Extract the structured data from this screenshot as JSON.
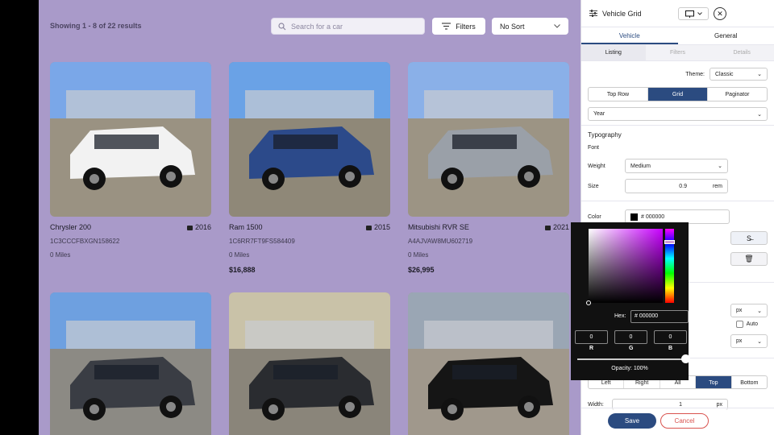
{
  "header": {
    "results_text": "Showing 1 - 8 of 22 results",
    "search_placeholder": "Search for a car",
    "filters_label": "Filters",
    "sort_label": "No Sort"
  },
  "cars": [
    {
      "name": "Chrysler 200",
      "year": "2016",
      "vin": "1C3CCCFBXGN158622",
      "miles": "0 Miles",
      "price": "",
      "body_color": "#f2f2f2",
      "sky": "#7aa7e8",
      "ground": "#9a9282"
    },
    {
      "name": "Ram 1500",
      "year": "2015",
      "vin": "1C6RR7FT9FS584409",
      "miles": "0 Miles",
      "price": "$16,888",
      "body_color": "#2c4a8a",
      "sky": "#6aa2e6",
      "ground": "#8f8878"
    },
    {
      "name": "Mitsubishi RVR SE",
      "year": "2021",
      "vin": "A4AJVAW8MU602719",
      "miles": "0 Miles",
      "price": "$26,995",
      "body_color": "#9aa0a8",
      "sky": "#8ab0e8",
      "ground": "#9c9484"
    },
    {
      "name": "",
      "year": "",
      "vin": "",
      "miles": "",
      "price": "",
      "body_color": "#3a3d44",
      "sky": "#6ea0e0",
      "ground": "#8c8a84"
    },
    {
      "name": "",
      "year": "",
      "vin": "",
      "miles": "",
      "price": "",
      "body_color": "#2a2c30",
      "sky": "#c9c2a8",
      "ground": "#8a857a"
    },
    {
      "name": "",
      "year": "",
      "vin": "",
      "miles": "",
      "price": "",
      "body_color": "#151515",
      "sky": "#9aa6b4",
      "ground": "#a0988c"
    }
  ],
  "panel": {
    "title": "Vehicle Grid",
    "tabs": [
      "Vehicle",
      "General"
    ],
    "subtabs": [
      "Listing",
      "Filters",
      "Details"
    ],
    "theme_label": "Theme:",
    "theme_value": "Classic",
    "layout_options": [
      "Top Row",
      "Grid",
      "Paginator"
    ],
    "year_select": "Year",
    "typography_heading": "Typography",
    "font_label": "Font",
    "weight_label": "Weight",
    "weight_value": "Medium",
    "size_label": "Size",
    "size_value": "0.9",
    "size_unit": "rem",
    "color_label": "Color",
    "color_value": "# 000000",
    "px_unit_a": "px",
    "auto_label": "Auto",
    "px_unit_b": "px",
    "position_options": [
      "Left",
      "Right",
      "All",
      "Top",
      "Bottom"
    ],
    "width_label": "Width:",
    "width_value": "1",
    "width_unit": "px",
    "save_label": "Save",
    "cancel_label": "Cancel"
  },
  "picker": {
    "hex_label": "Hex:",
    "hex_value": "# 000000",
    "r_value": "0",
    "g_value": "0",
    "b_value": "0",
    "r_label": "R",
    "g_label": "G",
    "b_label": "B",
    "opacity_label": "Opacity: 100%"
  },
  "colors": {
    "accent": "#2b4b80",
    "cancel": "#d9534f",
    "background": "#a99ac9"
  }
}
